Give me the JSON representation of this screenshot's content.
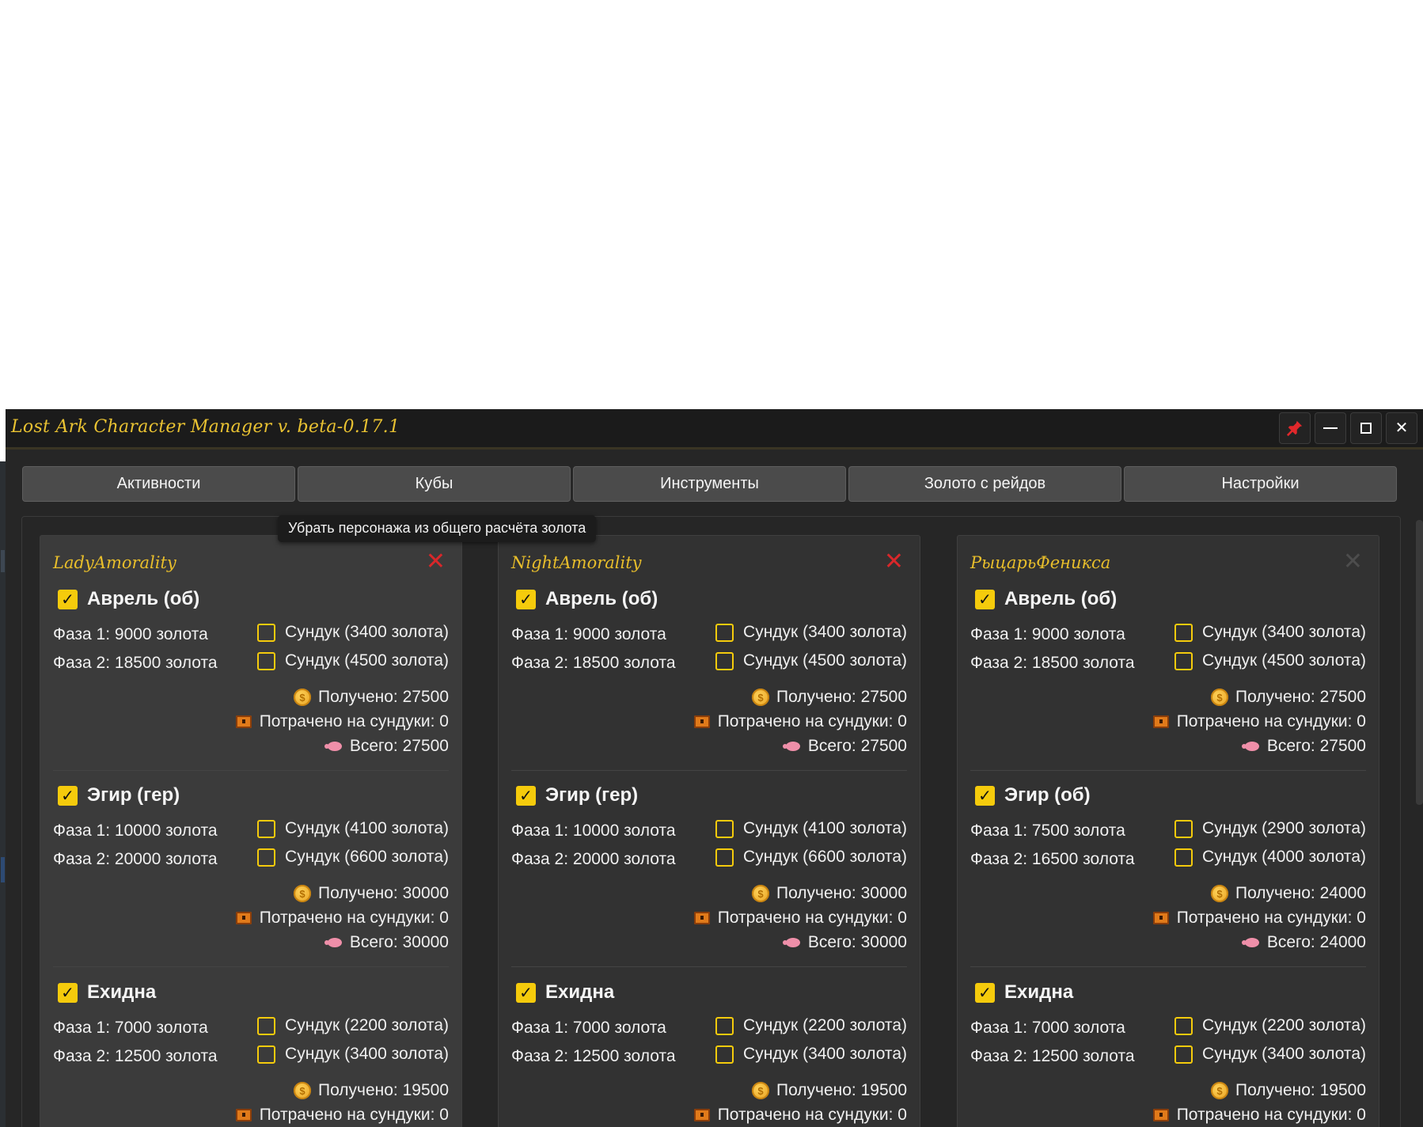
{
  "window": {
    "title": "Lost Ark Character Manager v. beta-0.17.1",
    "controls": {
      "pin": "📌",
      "minimize": "—",
      "maximize": "☐",
      "close": "✕"
    }
  },
  "tabs": [
    "Активности",
    "Кубы",
    "Инструменты",
    "Золото с рейдов",
    "Настройки"
  ],
  "tooltip": "Убрать персонажа из общего расчёта золота",
  "colors": {
    "accent": "#f5cb0c",
    "name": "#e8be2b",
    "remove": "#d9272a"
  },
  "icons": {
    "checkmark": "✓",
    "remove": "✕",
    "coin": "$"
  },
  "characters": [
    {
      "name": "LadyAmorality",
      "raids": [
        {
          "name": "Аврель (об)",
          "phase1": "Фаза 1: 9000 золота",
          "phase2": "Фаза 2: 18500 золота",
          "chest1": "Сундук (3400 золота)",
          "chest2": "Сундук (4500 золота)",
          "received": "Получено: 27500",
          "spent": "Потрачено на сундуки: 0",
          "total": "Всего: 27500"
        },
        {
          "name": "Эгир (гер)",
          "phase1": "Фаза 1: 10000 золота",
          "phase2": "Фаза 2: 20000 золота",
          "chest1": "Сундук (4100 золота)",
          "chest2": "Сундук (6600 золота)",
          "received": "Получено: 30000",
          "spent": "Потрачено на сундуки: 0",
          "total": "Всего: 30000"
        },
        {
          "name": "Ехидна",
          "phase1": "Фаза 1: 7000 золота",
          "phase2": "Фаза 2: 12500 золота",
          "chest1": "Сундук (2200 золота)",
          "chest2": "Сундук (3400 золота)",
          "received": "Получено: 19500",
          "spent": "Потрачено на сундуки: 0",
          "total": ""
        }
      ]
    },
    {
      "name": "NightAmorality",
      "raids": [
        {
          "name": "Аврель (об)",
          "phase1": "Фаза 1: 9000 золота",
          "phase2": "Фаза 2: 18500 золота",
          "chest1": "Сундук (3400 золота)",
          "chest2": "Сундук (4500 золота)",
          "received": "Получено: 27500",
          "spent": "Потрачено на сундуки: 0",
          "total": "Всего: 27500"
        },
        {
          "name": "Эгир (гер)",
          "phase1": "Фаза 1: 10000 золота",
          "phase2": "Фаза 2: 20000 золота",
          "chest1": "Сундук (4100 золота)",
          "chest2": "Сундук (6600 золота)",
          "received": "Получено: 30000",
          "spent": "Потрачено на сундуки: 0",
          "total": "Всего: 30000"
        },
        {
          "name": "Ехидна",
          "phase1": "Фаза 1: 7000 золота",
          "phase2": "Фаза 2: 12500 золота",
          "chest1": "Сундук (2200 золота)",
          "chest2": "Сундук (3400 золота)",
          "received": "Получено: 19500",
          "spent": "Потрачено на сундуки: 0",
          "total": ""
        }
      ]
    },
    {
      "name": "РыцарьФеникса",
      "raids": [
        {
          "name": "Аврель (об)",
          "phase1": "Фаза 1: 9000 золота",
          "phase2": "Фаза 2: 18500 золота",
          "chest1": "Сундук (3400 золота)",
          "chest2": "Сундук (4500 золота)",
          "received": "Получено: 27500",
          "spent": "Потрачено на сундуки: 0",
          "total": "Всего: 27500"
        },
        {
          "name": "Эгир (об)",
          "phase1": "Фаза 1: 7500 золота",
          "phase2": "Фаза 2: 16500 золота",
          "chest1": "Сундук (2900 золота)",
          "chest2": "Сундук (4000 золота)",
          "received": "Получено: 24000",
          "spent": "Потрачено на сундуки: 0",
          "total": "Всего: 24000"
        },
        {
          "name": "Ехидна",
          "phase1": "Фаза 1: 7000 золота",
          "phase2": "Фаза 2: 12500 золота",
          "chest1": "Сундук (2200 золота)",
          "chest2": "Сундук (3400 золота)",
          "received": "Получено: 19500",
          "spent": "Потрачено на сундуки: 0",
          "total": ""
        }
      ]
    }
  ]
}
